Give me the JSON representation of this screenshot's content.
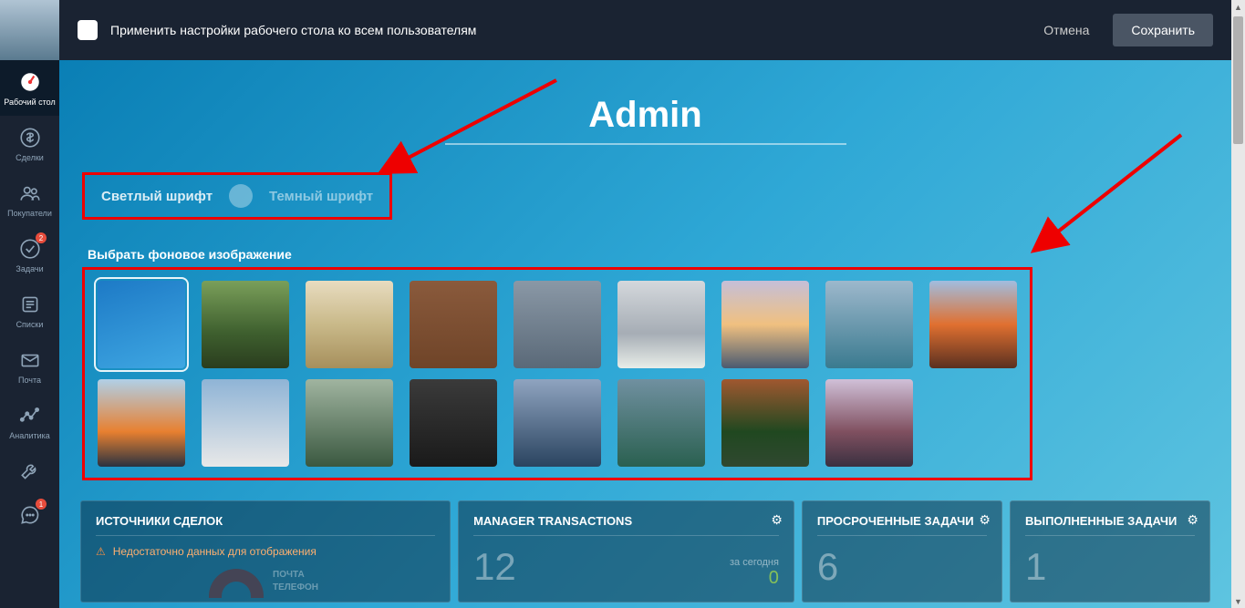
{
  "topbar": {
    "apply_all_label": "Применить настройки рабочего стола ко всем пользователям",
    "cancel_label": "Отмена",
    "save_label": "Сохранить"
  },
  "sidebar": {
    "items": [
      {
        "label": "Рабочий стол",
        "icon": "dashboard"
      },
      {
        "label": "Сделки",
        "icon": "dollar"
      },
      {
        "label": "Покупатели",
        "icon": "users"
      },
      {
        "label": "Задачи",
        "icon": "check",
        "badge": "2"
      },
      {
        "label": "Списки",
        "icon": "list"
      },
      {
        "label": "Почта",
        "icon": "mail"
      },
      {
        "label": "Аналитика",
        "icon": "analytics"
      },
      {
        "label": "",
        "icon": "wrench"
      },
      {
        "label": "",
        "icon": "chat",
        "badge": "1"
      }
    ]
  },
  "main": {
    "title": "Admin",
    "font_light_label": "Светлый шрифт",
    "font_dark_label": "Темный шрифт",
    "bg_section_label": "Выбрать фоновое изображение",
    "bg_selected_index": 0
  },
  "widgets": {
    "sources": {
      "title": "ИСТОЧНИКИ СДЕЛОК",
      "warn": "Недостаточно данных для отображения",
      "src1": "ПОЧТА",
      "src2": "ТЕЛЕФОН"
    },
    "manager": {
      "title": "MANAGER TRANSACTIONS",
      "value": "12",
      "today_label": "за сегодня",
      "today_value": "0"
    },
    "overdue": {
      "title": "ПРОСРОЧЕННЫЕ ЗАДАЧИ",
      "value": "6"
    },
    "done": {
      "title": "ВЫПОЛНЕННЫЕ ЗАДАЧИ",
      "value": "1"
    }
  }
}
